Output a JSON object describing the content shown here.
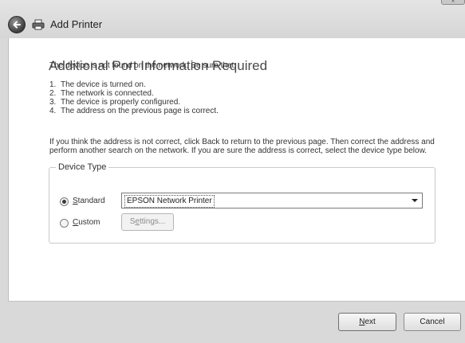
{
  "window": {
    "title": "Add Printer"
  },
  "page": {
    "heading": "Additional Port Information Required",
    "intro": "The device is not found on the network.  Be sure that:",
    "checklist": [
      {
        "num": "1.",
        "text": "The device is turned on."
      },
      {
        "num": "2.",
        "text": "The network is connected."
      },
      {
        "num": "3.",
        "text": "The device is properly configured."
      },
      {
        "num": "4.",
        "text": "The address on the previous page is correct."
      }
    ],
    "instructions": "If you think the address is not correct, click Back to return to the previous page.  Then correct the address and perform another search on the network.  If you are sure the address is correct, select the device type below."
  },
  "device_type": {
    "legend": "Device Type",
    "standard": {
      "label_hotkey": "S",
      "label_rest": "tandard",
      "selected": true
    },
    "custom": {
      "label_hotkey": "C",
      "label_rest": "ustom",
      "selected": false
    },
    "standard_select_value": "EPSON Network Printer",
    "settings_label_pre": "S",
    "settings_label_hotkey": "e",
    "settings_label_post": "ttings...",
    "settings_enabled": false
  },
  "footer": {
    "next_hotkey": "N",
    "next_rest": "ext",
    "cancel_label": "Cancel"
  },
  "icons": {
    "back": "back-arrow-icon",
    "printer": "printer-icon",
    "dropdown": "chevron-down-icon"
  }
}
